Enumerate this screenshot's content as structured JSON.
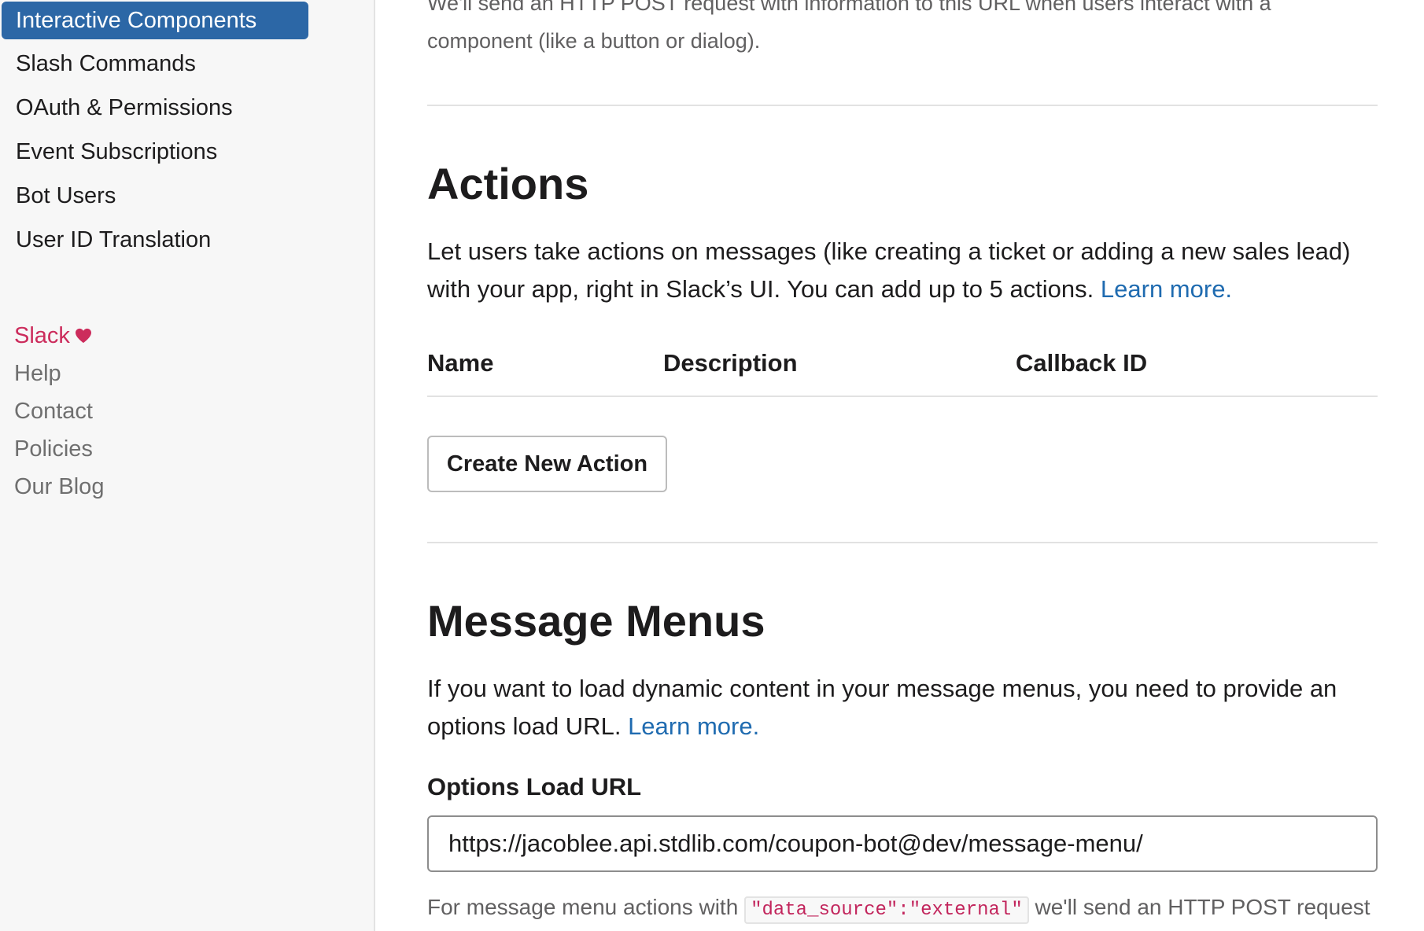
{
  "sidebar": {
    "items": [
      {
        "label": "Interactive Components"
      },
      {
        "label": "Slash Commands"
      },
      {
        "label": "OAuth & Permissions"
      },
      {
        "label": "Event Subscriptions"
      },
      {
        "label": "Bot Users"
      },
      {
        "label": "User ID Translation"
      }
    ],
    "footer": {
      "slack": "Slack",
      "help": "Help",
      "contact": "Contact",
      "policies": "Policies",
      "blog": "Our Blog"
    },
    "colors": {
      "active_bg": "#2c67a6",
      "slack_pink": "#cc2c5c"
    }
  },
  "main": {
    "clipped_top_text": "We'll send an HTTP POST request with information to this URL when users interact with a",
    "clipped_continuation": "component (like a button or dialog).",
    "actions": {
      "title": "Actions",
      "description": "Let users take actions on messages (like creating a ticket or adding a new sales lead) with your app, right in Slack’s UI. You can add up to 5 actions.",
      "learn_more": "Learn more.",
      "columns": [
        "Name",
        "Description",
        "Callback ID"
      ],
      "create_button": "Create New Action"
    },
    "message_menus": {
      "title": "Message Menus",
      "description": "If you want to load dynamic content in your message menus, you need to provide an options load URL.",
      "learn_more": "Learn more.",
      "field_label": "Options Load URL",
      "field_value": "https://jacoblee.api.stdlib.com/coupon-bot@dev/message-menu/",
      "footnote_prefix": "For message menu actions with",
      "footnote_code": "\"data_source\":\"external\"",
      "footnote_suffix": "we'll send an HTTP POST request"
    },
    "colors": {
      "link": "#1f6bb0",
      "code": "#c2255c"
    }
  }
}
